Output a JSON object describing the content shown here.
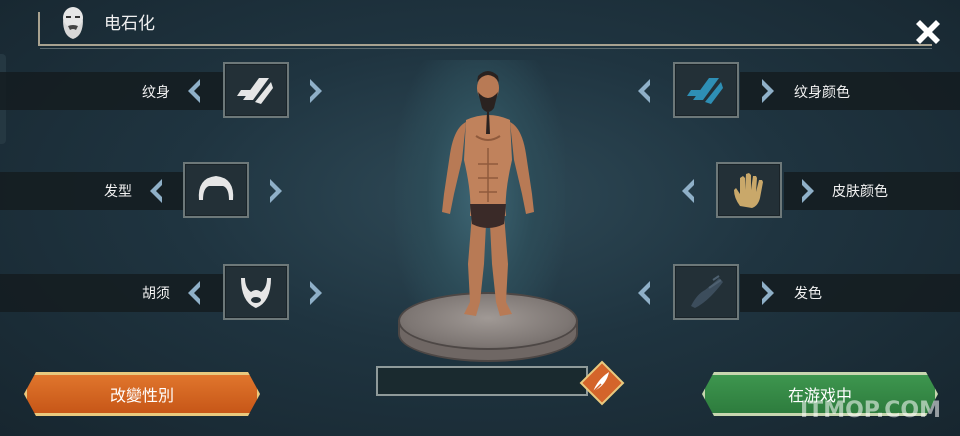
{
  "header": {
    "title": "电石化",
    "title_icon": "bearded-face-icon",
    "close_icon": "close-icon"
  },
  "options_left": [
    {
      "label": "纹身",
      "icon": "tattoo-rune-icon"
    },
    {
      "label": "发型",
      "icon": "hairstyle-icon"
    },
    {
      "label": "胡须",
      "icon": "beard-icon"
    }
  ],
  "options_right": [
    {
      "label": "纹身颜色",
      "icon": "tattoo-rune-icon",
      "icon_color": "#2e8fb5"
    },
    {
      "label": "皮肤颜色",
      "icon": "hand-icon",
      "icon_color": "#c9a86a"
    },
    {
      "label": "发色",
      "icon": "hair-braid-icon",
      "icon_color": "#3c4d5c"
    }
  ],
  "name_field": {
    "value": "",
    "edit_icon": "quill-icon"
  },
  "buttons": {
    "change_gender": "改變性別",
    "enter_game": "在游戏中"
  },
  "watermark": "ITMOP.COM",
  "colors": {
    "arrow": "#8fb0c8",
    "orange_button": "#d4642a",
    "green_button": "#37894a"
  }
}
